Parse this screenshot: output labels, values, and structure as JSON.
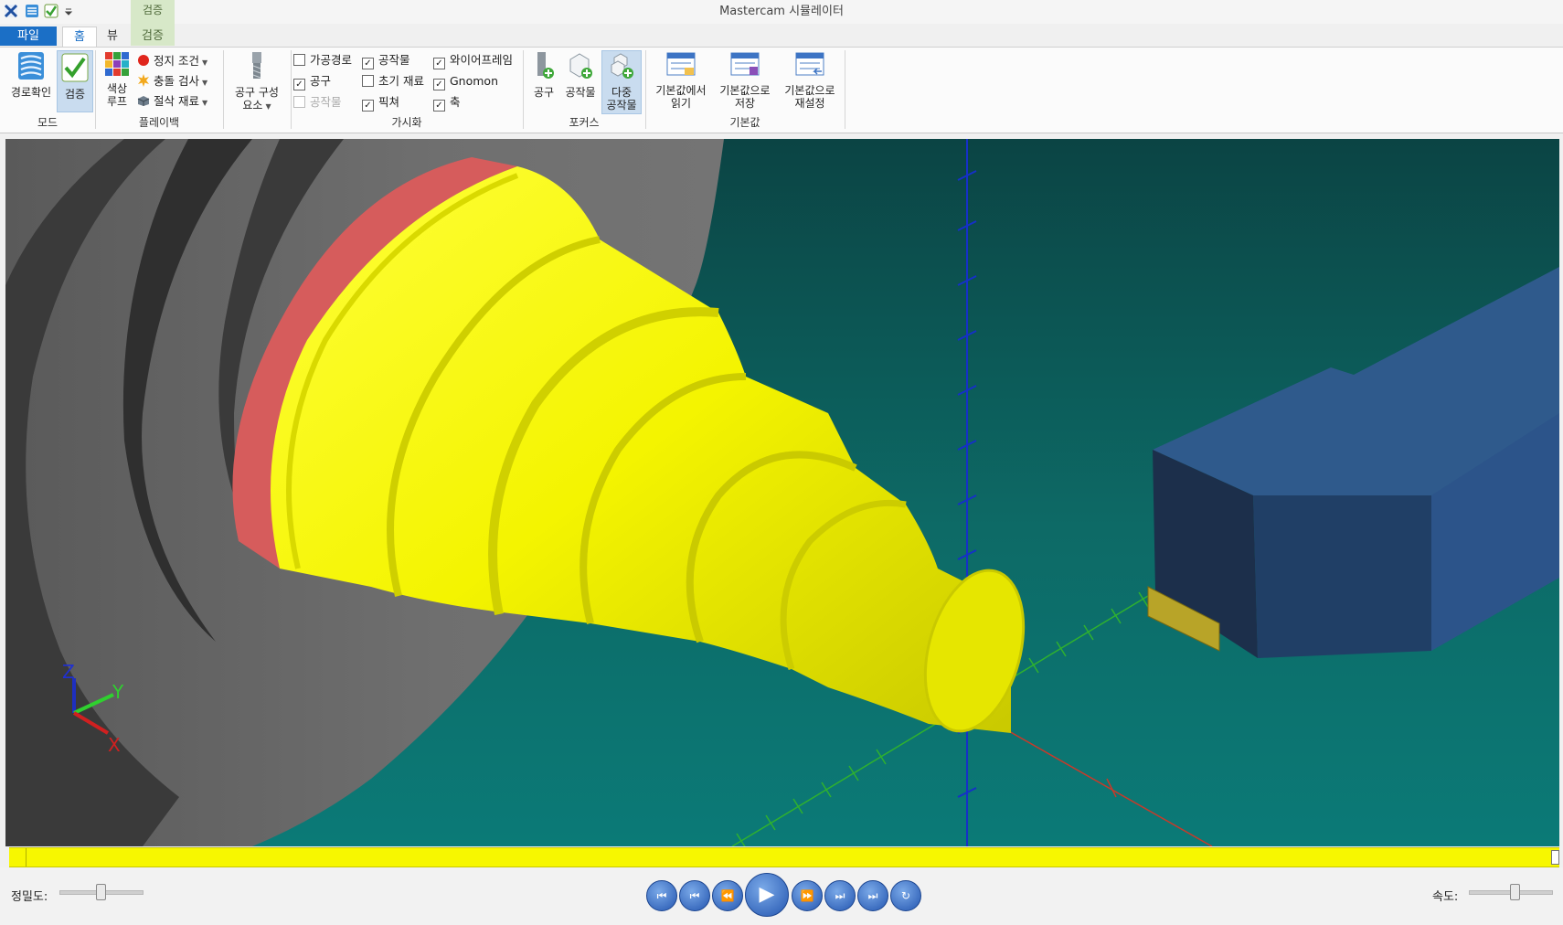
{
  "app": {
    "title": "Mastercam 시뮬레이터"
  },
  "quick_access": [
    {
      "icon": "mastercam-logo-icon"
    },
    {
      "icon": "backplot-icon"
    },
    {
      "icon": "verify-icon"
    },
    {
      "icon": "customize-dropdown-icon"
    }
  ],
  "context_group": {
    "label": "검증"
  },
  "tabs": [
    {
      "label": "파일"
    },
    {
      "label": "홈"
    },
    {
      "label": "뷰"
    },
    {
      "label": "검증"
    }
  ],
  "ribbon": {
    "mode": {
      "label": "모드",
      "backplot_label": "경로확인",
      "verify_label": "검증"
    },
    "playback": {
      "label": "플레이백",
      "color_loop_label_1": "색상",
      "color_loop_label_2": "루프",
      "stop_conditions_label": "정지 조건",
      "collision_check_label": "충돌 검사",
      "cut_stock_label": "절삭 재료"
    },
    "tool_components": {
      "label_1": "공구 구성",
      "label_2": "요소"
    },
    "visibility": {
      "label": "가시화",
      "toolpath": {
        "label": "가공경로",
        "checked": false
      },
      "workpiece": {
        "label": "공작물",
        "checked": true
      },
      "wireframe": {
        "label": "와이어프레임",
        "checked": true
      },
      "tool": {
        "label": "공구",
        "checked": true
      },
      "initial_stock": {
        "label": "초기 재료",
        "checked": false
      },
      "gnomon": {
        "label": "Gnomon",
        "checked": true
      },
      "workpiece_disabled": {
        "label": "공작물",
        "checked": false
      },
      "fixture": {
        "label": "픽쳐",
        "checked": true
      },
      "axes": {
        "label": "축",
        "checked": true
      }
    },
    "focus": {
      "label": "포커스",
      "tool_label": "공구",
      "workpiece_label": "공작물",
      "multi_label_1": "다중",
      "multi_label_2": "공작물"
    },
    "defaults": {
      "label": "기본값",
      "load_label_1": "기본값에서",
      "load_label_2": "읽기",
      "save_label_1": "기본값으로",
      "save_label_2": "저장",
      "reset_label_1": "기본값으로",
      "reset_label_2": "재설정"
    }
  },
  "gnomon": {
    "x": "X",
    "y": "Y",
    "z": "Z"
  },
  "bottom": {
    "accuracy_label": "정밀도:",
    "speed_label": "속도:",
    "accuracy_level": 0.5,
    "speed_level": 0.55,
    "progress": 1.0
  },
  "colors": {
    "accent": "#1b6fc6",
    "workpiece": "#f5f500",
    "background": "#0d6d6a",
    "timeline": "#f7f700"
  }
}
